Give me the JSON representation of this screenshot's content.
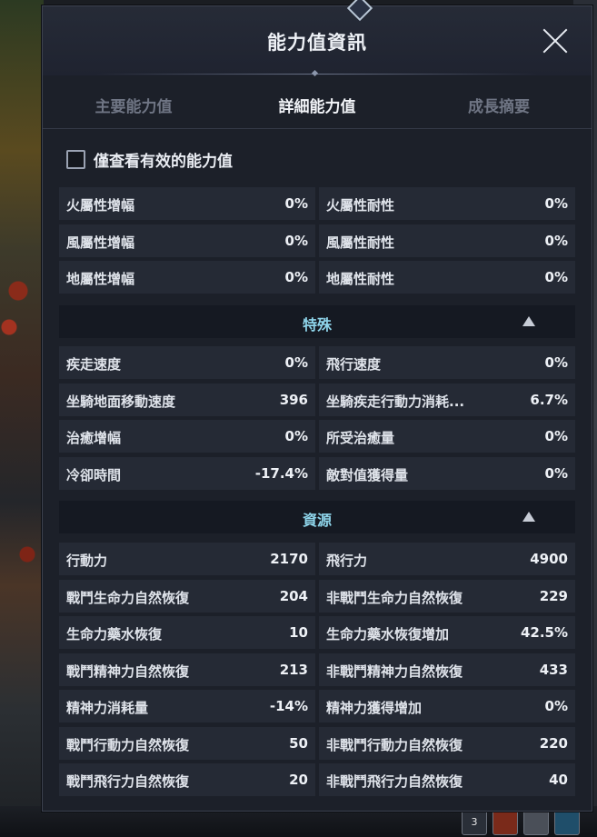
{
  "window": {
    "title": "能力值資訊"
  },
  "tabs": [
    {
      "label": "主要能力值",
      "active": false
    },
    {
      "label": "詳細能力值",
      "active": true
    },
    {
      "label": "成長摘要",
      "active": false
    }
  ],
  "filter": {
    "label": "僅查看有效的能力值",
    "checked": false
  },
  "elemental": {
    "rows": [
      [
        {
          "label": "火屬性增幅",
          "value": "0%"
        },
        {
          "label": "火屬性耐性",
          "value": "0%"
        }
      ],
      [
        {
          "label": "風屬性增幅",
          "value": "0%"
        },
        {
          "label": "風屬性耐性",
          "value": "0%"
        }
      ],
      [
        {
          "label": "地屬性增幅",
          "value": "0%"
        },
        {
          "label": "地屬性耐性",
          "value": "0%"
        }
      ]
    ]
  },
  "special": {
    "title": "特殊",
    "rows": [
      [
        {
          "label": "疾走速度",
          "value": "0%"
        },
        {
          "label": "飛行速度",
          "value": "0%"
        }
      ],
      [
        {
          "label": "坐騎地面移動速度",
          "value": "396"
        },
        {
          "label": "坐騎疾走行動力消耗...",
          "value": "6.7%"
        }
      ],
      [
        {
          "label": "治癒增幅",
          "value": "0%"
        },
        {
          "label": "所受治癒量",
          "value": "0%"
        }
      ],
      [
        {
          "label": "冷卻時間",
          "value": "-17.4%"
        },
        {
          "label": "敵對值獲得量",
          "value": "0%"
        }
      ]
    ]
  },
  "resources": {
    "title": "資源",
    "rows": [
      [
        {
          "label": "行動力",
          "value": "2170"
        },
        {
          "label": "飛行力",
          "value": "4900"
        }
      ],
      [
        {
          "label": "戰鬥生命力自然恢復",
          "value": "204"
        },
        {
          "label": "非戰鬥生命力自然恢復",
          "value": "229"
        }
      ],
      [
        {
          "label": "生命力藥水恢復",
          "value": "10"
        },
        {
          "label": "生命力藥水恢復增加",
          "value": "42.5%"
        }
      ],
      [
        {
          "label": "戰鬥精神力自然恢復",
          "value": "213"
        },
        {
          "label": "非戰鬥精神力自然恢復",
          "value": "433"
        }
      ],
      [
        {
          "label": "精神力消耗量",
          "value": "-14%"
        },
        {
          "label": "精神力獲得增加",
          "value": "0%"
        }
      ],
      [
        {
          "label": "戰鬥行動力自然恢復",
          "value": "50"
        },
        {
          "label": "非戰鬥行動力自然恢復",
          "value": "220"
        }
      ],
      [
        {
          "label": "戰鬥飛行力自然恢復",
          "value": "20"
        },
        {
          "label": "非戰鬥飛行力自然恢復",
          "value": "40"
        }
      ]
    ]
  },
  "hud": {
    "slot_count": "3"
  },
  "colors": {
    "section_title": "#8ed4ea",
    "panel_bg": "#1c2029",
    "cell_bg": "#252a35"
  }
}
